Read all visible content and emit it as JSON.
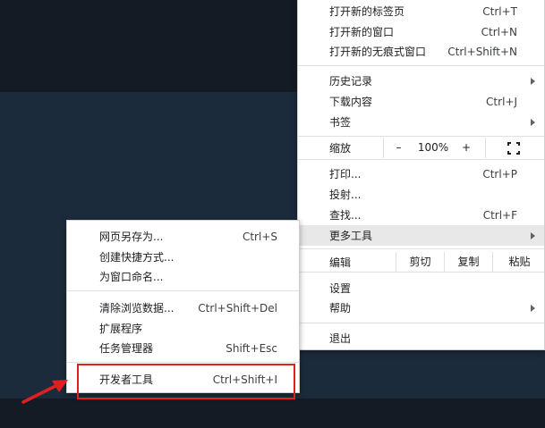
{
  "main_menu": {
    "new_tab": {
      "label": "打开新的标签页",
      "shortcut": "Ctrl+T"
    },
    "new_window": {
      "label": "打开新的窗口",
      "shortcut": "Ctrl+N"
    },
    "new_incognito": {
      "label": "打开新的无痕式窗口",
      "shortcut": "Ctrl+Shift+N"
    },
    "history": {
      "label": "历史记录"
    },
    "downloads": {
      "label": "下载内容",
      "shortcut": "Ctrl+J"
    },
    "bookmarks": {
      "label": "书签"
    },
    "zoom": {
      "label": "缩放",
      "minus": "–",
      "value": "100%",
      "plus": "+"
    },
    "print": {
      "label": "打印...",
      "shortcut": "Ctrl+P"
    },
    "cast": {
      "label": "投射..."
    },
    "find": {
      "label": "查找...",
      "shortcut": "Ctrl+F"
    },
    "more_tools": {
      "label": "更多工具"
    },
    "edit": {
      "label": "编辑",
      "cut": "剪切",
      "copy": "复制",
      "paste": "粘贴"
    },
    "settings": {
      "label": "设置"
    },
    "help": {
      "label": "帮助"
    },
    "exit": {
      "label": "退出"
    }
  },
  "sub_menu": {
    "save_page": {
      "label": "网页另存为...",
      "shortcut": "Ctrl+S"
    },
    "create_shortcut": {
      "label": "创建快捷方式..."
    },
    "name_window": {
      "label": "为窗口命名..."
    },
    "clear_data": {
      "label": "清除浏览数据...",
      "shortcut": "Ctrl+Shift+Del"
    },
    "extensions": {
      "label": "扩展程序"
    },
    "task_manager": {
      "label": "任务管理器",
      "shortcut": "Shift+Esc"
    },
    "dev_tools": {
      "label": "开发者工具",
      "shortcut": "Ctrl+Shift+I"
    }
  },
  "icons": {
    "fullscreen": "fullscreen-icon",
    "submenu_arrow": "chevron-right-icon",
    "annotation_arrow": "pointer-arrow-icon"
  },
  "colors": {
    "annotation": "#e02020",
    "highlight_row": "#e8e8e8"
  }
}
